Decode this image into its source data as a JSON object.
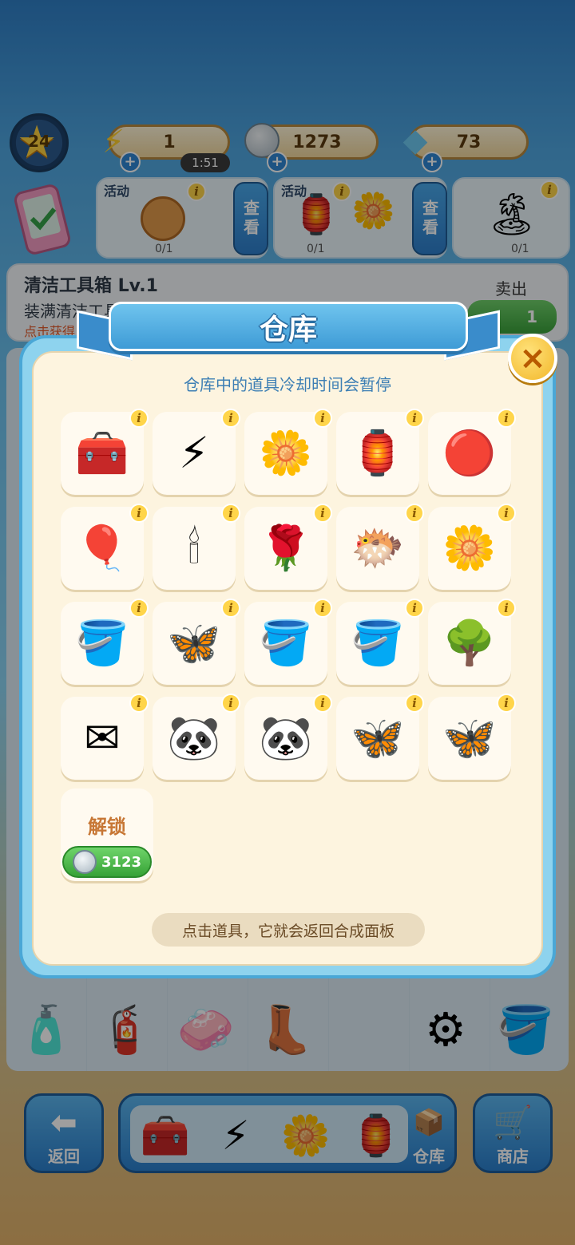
{
  "hud": {
    "level": "24",
    "energy": "1",
    "energy_timer": "1:51",
    "coins": "1273",
    "gems": "73"
  },
  "events": [
    {
      "tag": "活动",
      "progress": "0/1",
      "view_label": "查看",
      "icon": "coin-token-icon"
    },
    {
      "tag": "活动",
      "progress": "0/1",
      "view_label": "查看",
      "icon": "birdcage-icon"
    },
    {
      "tag": "",
      "progress": "0/1",
      "view_label": "",
      "icon": "ruins-island-icon"
    }
  ],
  "toolbox": {
    "title": "清洁工具箱 Lv.1",
    "line2": "装满清洁工具箱",
    "line3": "点击获得",
    "sell_label": "卖出",
    "sell_value": "1"
  },
  "modal": {
    "title": "仓库",
    "subtitle": "仓库中的道具冷却时间会暂停",
    "info_glyph": "i",
    "items": [
      {
        "icon": "treasure-chest-icon",
        "glyph": "🧰"
      },
      {
        "icon": "blue-energy-orb-icon",
        "glyph": "⚡"
      },
      {
        "icon": "flower-planter-icon",
        "glyph": "🌼"
      },
      {
        "icon": "birdcage-icon",
        "glyph": "🏮"
      },
      {
        "icon": "red-energy-orb-icon",
        "glyph": "🔴"
      },
      {
        "icon": "heart-balloons-icon",
        "glyph": "🎈"
      },
      {
        "icon": "candelabra-icon",
        "glyph": "🕯"
      },
      {
        "icon": "rose-arch-icon",
        "glyph": "🌹"
      },
      {
        "icon": "pufferfish-icon",
        "glyph": "🐡"
      },
      {
        "icon": "flower-planter-icon",
        "glyph": "🌼"
      },
      {
        "icon": "paint-bucket-icon",
        "glyph": "🪣"
      },
      {
        "icon": "butterfly-wing-icon",
        "glyph": "🦋"
      },
      {
        "icon": "paint-bucket-icon",
        "glyph": "🪣"
      },
      {
        "icon": "paint-bucket-icon",
        "glyph": "🪣"
      },
      {
        "icon": "bush-island-icon",
        "glyph": "🌳"
      },
      {
        "icon": "letters-icon",
        "glyph": "✉"
      },
      {
        "icon": "panda-icon",
        "glyph": "🐼"
      },
      {
        "icon": "panda-icon",
        "glyph": "🐼"
      },
      {
        "icon": "butterfly-wing-icon",
        "glyph": "🦋"
      },
      {
        "icon": "butterfly-wing-icon",
        "glyph": "🦋"
      }
    ],
    "unlock_label": "解锁",
    "unlock_price": "3123",
    "hint": "点击道具，它就会返回合成面板",
    "close_glyph": "×"
  },
  "board_items": [
    {
      "icon": "detergent-bottle-icon",
      "glyph": "🧴"
    },
    {
      "icon": "spray-bottle-icon",
      "glyph": "🧯"
    },
    {
      "icon": "soap-bar-icon",
      "glyph": "🧼"
    },
    {
      "icon": "rubber-boot-icon",
      "glyph": "👢"
    },
    {
      "icon": "steel-pipes-icon",
      "glyph": "⚙"
    },
    {
      "icon": "paint-bucket-icon",
      "glyph": "🪣"
    }
  ],
  "nav": {
    "back_label": "返回",
    "back_glyph": "⬅",
    "storage_label": "仓库",
    "storage_glyph": "📦",
    "shop_label": "商店",
    "shop_glyph": "🛒",
    "storage_preview": [
      {
        "icon": "treasure-chest-icon",
        "glyph": "🧰"
      },
      {
        "icon": "blue-energy-orb-icon",
        "glyph": "⚡"
      },
      {
        "icon": "flower-planter-icon",
        "glyph": "🌼"
      },
      {
        "icon": "birdcage-icon",
        "glyph": "🏮"
      }
    ]
  }
}
